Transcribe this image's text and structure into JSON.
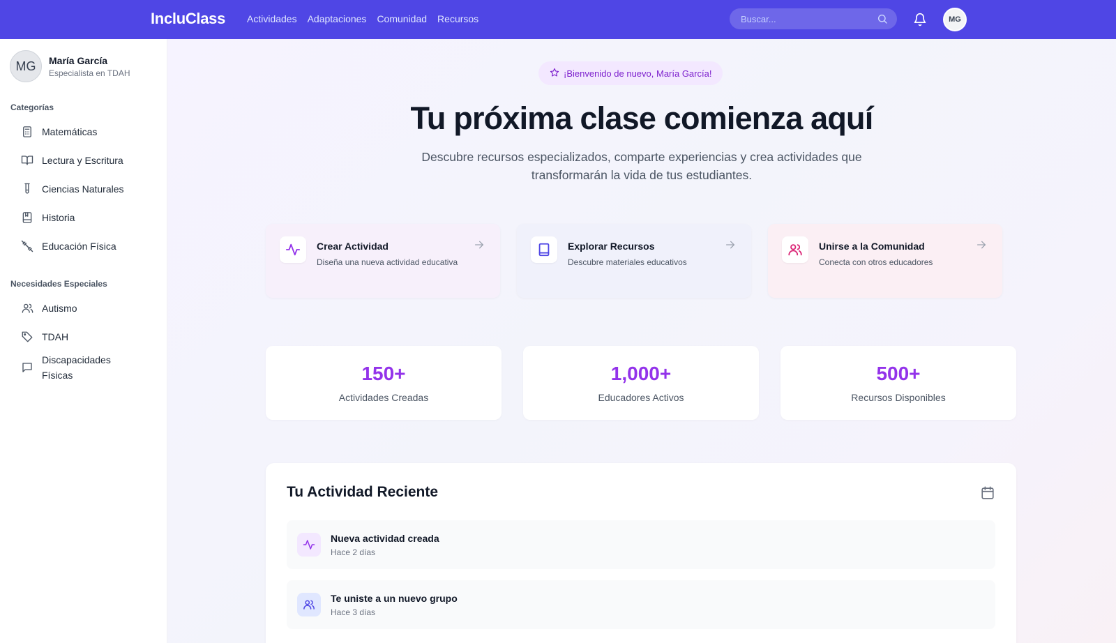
{
  "header": {
    "brand": "IncluClass",
    "nav": [
      "Actividades",
      "Adaptaciones",
      "Comunidad",
      "Recursos"
    ],
    "search_placeholder": "Buscar...",
    "avatar_initials": "MG",
    "icons": [
      "search-icon",
      "bell-icon"
    ]
  },
  "sidebar": {
    "profile": {
      "initials": "MG",
      "name": "María García",
      "role": "Especialista en TDAH"
    },
    "categories_title": "Categorías",
    "categories": [
      {
        "label": "Matemáticas",
        "icon": "calculator-icon"
      },
      {
        "label": "Lectura y Escritura",
        "icon": "book-open-icon"
      },
      {
        "label": "Ciencias Naturales",
        "icon": "test-tube-icon"
      },
      {
        "label": "Historia",
        "icon": "history-book-icon"
      },
      {
        "label": "Educación Física",
        "icon": "dumbbell-icon"
      }
    ],
    "needs_title": "Necesidades Especiales",
    "needs": [
      {
        "label": "Autismo",
        "icon": "users-icon"
      },
      {
        "label": "TDAH",
        "icon": "tag-icon"
      },
      {
        "label": "Discapacidades Físicas",
        "icon": "message-square-icon"
      }
    ]
  },
  "main": {
    "welcome": "¡Bienvenido de nuevo, María García!",
    "hero_title": "Tu próxima clase comienza aquí",
    "hero_subtitle": "Descubre recursos especializados, comparte experiencias y crea actividades que transformarán la vida de tus estudiantes.",
    "actions": [
      {
        "title": "Crear Actividad",
        "desc": "Diseña una nueva actividad educativa",
        "icon": "activity-icon",
        "bg": "#f7f0fb",
        "color": "#9333ea"
      },
      {
        "title": "Explorar Recursos",
        "desc": "Descubre materiales educativos",
        "icon": "book-icon",
        "bg": "#f0f1fb",
        "color": "#4f46e5"
      },
      {
        "title": "Unirse a la Comunidad",
        "desc": "Conecta con otros educadores",
        "icon": "users-icon",
        "bg": "#fbeff4",
        "color": "#db2777"
      }
    ],
    "stats": [
      {
        "value": "150+",
        "label": "Actividades Creadas"
      },
      {
        "value": "1,000+",
        "label": "Educadores Activos"
      },
      {
        "value": "500+",
        "label": "Recursos Disponibles"
      }
    ],
    "recent": {
      "title": "Tu Actividad Reciente",
      "items": [
        {
          "title": "Nueva actividad creada",
          "time": "Hace 2 días",
          "icon": "activity-icon"
        },
        {
          "title": "Te uniste a un nuevo grupo",
          "time": "Hace 3 días",
          "icon": "users-icon"
        }
      ]
    }
  },
  "colors": {
    "primary": "#4f46e5",
    "accent": "#9333ea",
    "pink": "#db2777"
  }
}
